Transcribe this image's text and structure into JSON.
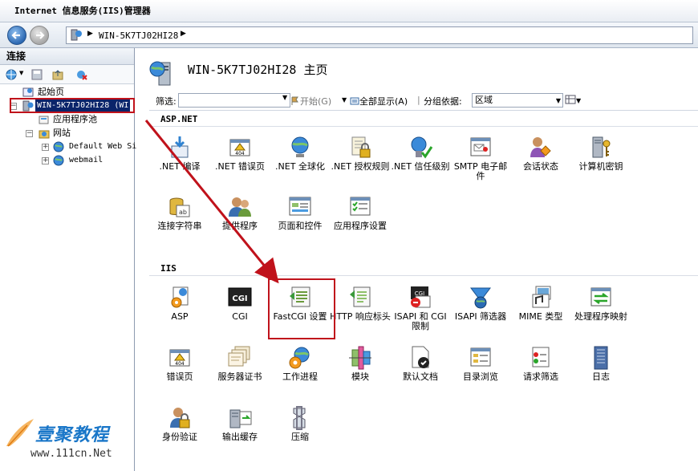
{
  "window": {
    "title": "Internet 信息服务(IIS)管理器"
  },
  "address": {
    "path": "WIN-5K7TJ02HI28",
    "sep": "▶"
  },
  "connections": {
    "header": "连接",
    "toolbar": [
      "connect-globe-icon",
      "save-icon",
      "up-folder-icon",
      "disconnect-icon"
    ],
    "tree": [
      {
        "label": "起始页",
        "icon": "start-page-icon"
      },
      {
        "label": "WIN-5K7TJ02HI28 (WI",
        "icon": "server-icon",
        "selected": true
      },
      {
        "label": "应用程序池",
        "icon": "app-pool-icon"
      },
      {
        "label": "网站",
        "icon": "sites-folder-icon"
      },
      {
        "label": "Default Web Si",
        "icon": "website-globe-icon"
      },
      {
        "label": "webmail",
        "icon": "website-globe-icon"
      }
    ]
  },
  "main": {
    "title": "WIN-5K7TJ02HI28 主页",
    "filter": {
      "label": "筛选:",
      "start": "开始(G)",
      "show_all": "全部显示(A)",
      "group_label": "分组依据:",
      "group_value": "区域"
    },
    "sections": [
      {
        "name": "ASP.NET",
        "items": [
          {
            "label": ".NET 编译",
            "icon": "dotnet-compile-icon"
          },
          {
            "label": ".NET 错误页",
            "icon": "dotnet-error-page-icon"
          },
          {
            "label": ".NET 全球化",
            "icon": "dotnet-globalization-icon"
          },
          {
            "label": ".NET 授权规则",
            "icon": "dotnet-authorization-icon"
          },
          {
            "label": ".NET 信任级别",
            "icon": "dotnet-trust-icon"
          },
          {
            "label": "SMTP 电子邮件",
            "icon": "smtp-email-icon"
          },
          {
            "label": "会话状态",
            "icon": "session-state-icon"
          },
          {
            "label": "计算机密钥",
            "icon": "machine-key-icon"
          },
          {
            "label": "连接字符串",
            "icon": "connection-string-icon"
          },
          {
            "label": "提供程序",
            "icon": "providers-icon"
          },
          {
            "label": "页面和控件",
            "icon": "pages-controls-icon"
          },
          {
            "label": "应用程序设置",
            "icon": "app-settings-icon"
          }
        ]
      },
      {
        "name": "IIS",
        "items": [
          {
            "label": "ASP",
            "icon": "asp-icon"
          },
          {
            "label": "CGI",
            "icon": "cgi-icon"
          },
          {
            "label": "FastCGI 设置",
            "icon": "fastcgi-icon"
          },
          {
            "label": "HTTP 响应标头",
            "icon": "http-response-headers-icon"
          },
          {
            "label": "ISAPI 和 CGI 限制",
            "icon": "isapi-cgi-restrictions-icon"
          },
          {
            "label": "ISAPI 筛选器",
            "icon": "isapi-filters-icon"
          },
          {
            "label": "MIME 类型",
            "icon": "mime-types-icon"
          },
          {
            "label": "处理程序映射",
            "icon": "handler-mappings-icon"
          },
          {
            "label": "错误页",
            "icon": "error-pages-icon"
          },
          {
            "label": "服务器证书",
            "icon": "server-certificates-icon"
          },
          {
            "label": "工作进程",
            "icon": "worker-processes-icon"
          },
          {
            "label": "模块",
            "icon": "modules-icon"
          },
          {
            "label": "默认文档",
            "icon": "default-document-icon"
          },
          {
            "label": "目录浏览",
            "icon": "directory-browsing-icon"
          },
          {
            "label": "请求筛选",
            "icon": "request-filtering-icon"
          },
          {
            "label": "日志",
            "icon": "logging-icon"
          },
          {
            "label": "身份验证",
            "icon": "authentication-icon"
          },
          {
            "label": "输出缓存",
            "icon": "output-caching-icon"
          },
          {
            "label": "压缩",
            "icon": "compression-icon"
          }
        ]
      }
    ]
  },
  "watermark": {
    "text": "壹聚教程",
    "url": "www.111cn.Net"
  },
  "colors": {
    "highlight": "#c0121b",
    "selection": "#0a246a"
  }
}
